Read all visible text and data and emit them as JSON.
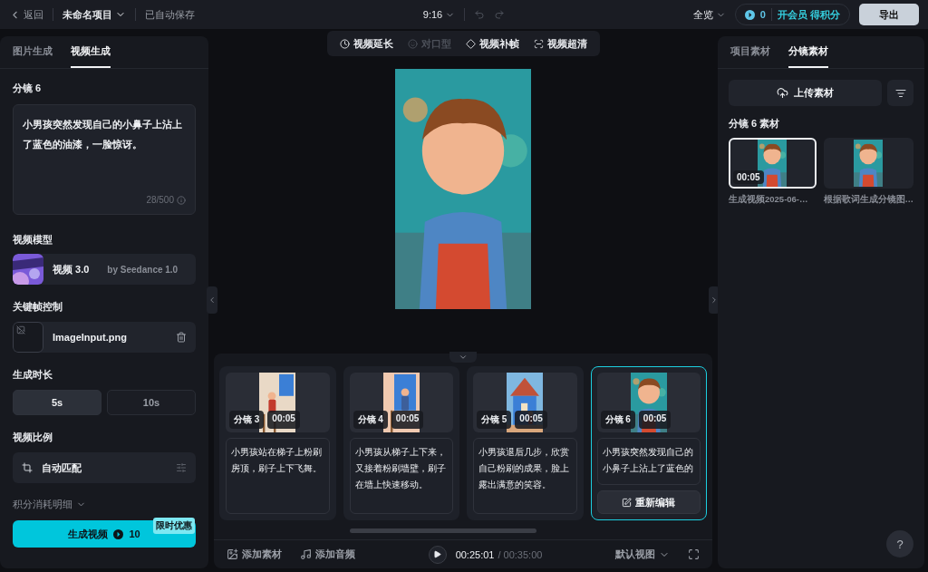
{
  "topbar": {
    "back": "返回",
    "project": "未命名项目",
    "save_status": "已自动保存",
    "ratio": "9:16",
    "zoom": "全览",
    "points": "0",
    "member": "开会员 得积分",
    "export": "导出"
  },
  "left_panel": {
    "tabs": [
      {
        "label": "图片生成",
        "selected": false
      },
      {
        "label": "视频生成",
        "selected": true
      }
    ],
    "shot_title": "分镜 6",
    "prompt": "小男孩突然发现自己的小鼻子上沾上了蓝色的油漆，一脸惊讶。",
    "prompt_count": "28/500",
    "model_label": "视频模型",
    "model": {
      "name": "视频 3.0",
      "by": "by Seedance 1.0"
    },
    "keyframe_label": "关键帧控制",
    "keyframe_file": "ImageInput.png",
    "duration_label": "生成时长",
    "durations": [
      {
        "label": "5s",
        "selected": true
      },
      {
        "label": "10s",
        "selected": false
      }
    ],
    "ratio_label": "视频比例",
    "ratio_value": "自动匹配",
    "cost_detail": "积分消耗明细",
    "generate": {
      "label": "生成视频",
      "cost": "10",
      "badge": "限时优惠"
    }
  },
  "tools": [
    {
      "kind": "extend",
      "label": "视频延长",
      "disabled": false
    },
    {
      "kind": "lipsync",
      "label": "对口型",
      "disabled": true
    },
    {
      "kind": "interpolate",
      "label": "视频补帧",
      "disabled": false
    },
    {
      "kind": "upscale",
      "label": "视频超清",
      "disabled": false
    }
  ],
  "timeline": {
    "shots": [
      {
        "label": "分镜 3",
        "duration": "00:05",
        "text": "小男孩站在梯子上粉刷房顶，刷子上下飞舞。",
        "selected": false
      },
      {
        "label": "分镜 4",
        "duration": "00:05",
        "text": "小男孩从梯子上下来，又接着粉刷墙壁，刷子在墙上快速移动。",
        "selected": false
      },
      {
        "label": "分镜 5",
        "duration": "00:05",
        "text": "小男孩退后几步，欣赏自己粉刷的成果，脸上露出满意的笑容。",
        "selected": false
      },
      {
        "label": "分镜 6",
        "duration": "00:05",
        "text": "小男孩突然发现自己的小鼻子上沾上了蓝色的",
        "selected": true
      }
    ],
    "action": "重新编辑"
  },
  "bottom_bar": {
    "add_media": "添加素材",
    "add_audio": "添加音频",
    "current_time": "00:25:01",
    "total_time": "/ 00:35:00",
    "view": "默认视图"
  },
  "right_panel": {
    "tabs": [
      {
        "label": "项目素材",
        "selected": false
      },
      {
        "label": "分镜素材",
        "selected": true
      }
    ],
    "upload": "上传素材",
    "section_title": "分镜 6 素材",
    "assets": [
      {
        "name": "生成视频2025-06-…",
        "duration": "00:05",
        "selected": true
      },
      {
        "name": "根据歌词生成分镜图…",
        "selected": false
      }
    ]
  },
  "help": "?"
}
